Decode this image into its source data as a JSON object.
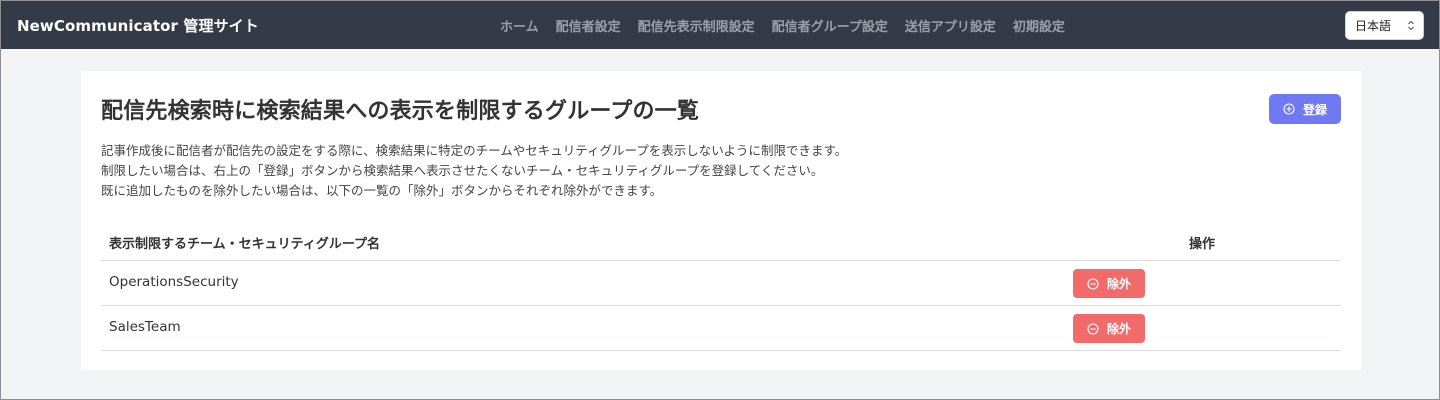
{
  "header": {
    "brand": "NewCommunicator 管理サイト",
    "nav": [
      {
        "label": "ホーム"
      },
      {
        "label": "配信者設定"
      },
      {
        "label": "配信先表示制限設定"
      },
      {
        "label": "配信者グループ設定"
      },
      {
        "label": "送信アプリ設定"
      },
      {
        "label": "初期設定"
      }
    ],
    "language": {
      "selected": "日本語"
    }
  },
  "page": {
    "title": "配信先検索時に検索結果への表示を制限するグループの一覧",
    "register_label": "登録",
    "description": [
      "記事作成後に配信者が配信先の設定をする際に、検索結果に特定のチームやセキュリティグループを表示しないように制限できます。",
      "制限したい場合は、右上の「登録」ボタンから検索結果へ表示させたくないチーム・セキュリティグループを登録してください。",
      "既に追加したものを除外したい場合は、以下の一覧の「除外」ボタンからそれぞれ除外ができます。"
    ]
  },
  "table": {
    "columns": {
      "name": "表示制限するチーム・セキュリティグループ名",
      "action": "操作"
    },
    "rows": [
      {
        "name": "OperationsSecurity",
        "action_label": "除外"
      },
      {
        "name": "SalesTeam",
        "action_label": "除外"
      }
    ]
  },
  "colors": {
    "header_bg": "#343a46",
    "primary": "#6f79f2",
    "danger": "#f26b6b",
    "page_bg": "#f2f3f5"
  },
  "icons": {
    "register": "plus-circle-icon",
    "remove": "minus-circle-icon",
    "language": "chevron-up-down-icon"
  }
}
